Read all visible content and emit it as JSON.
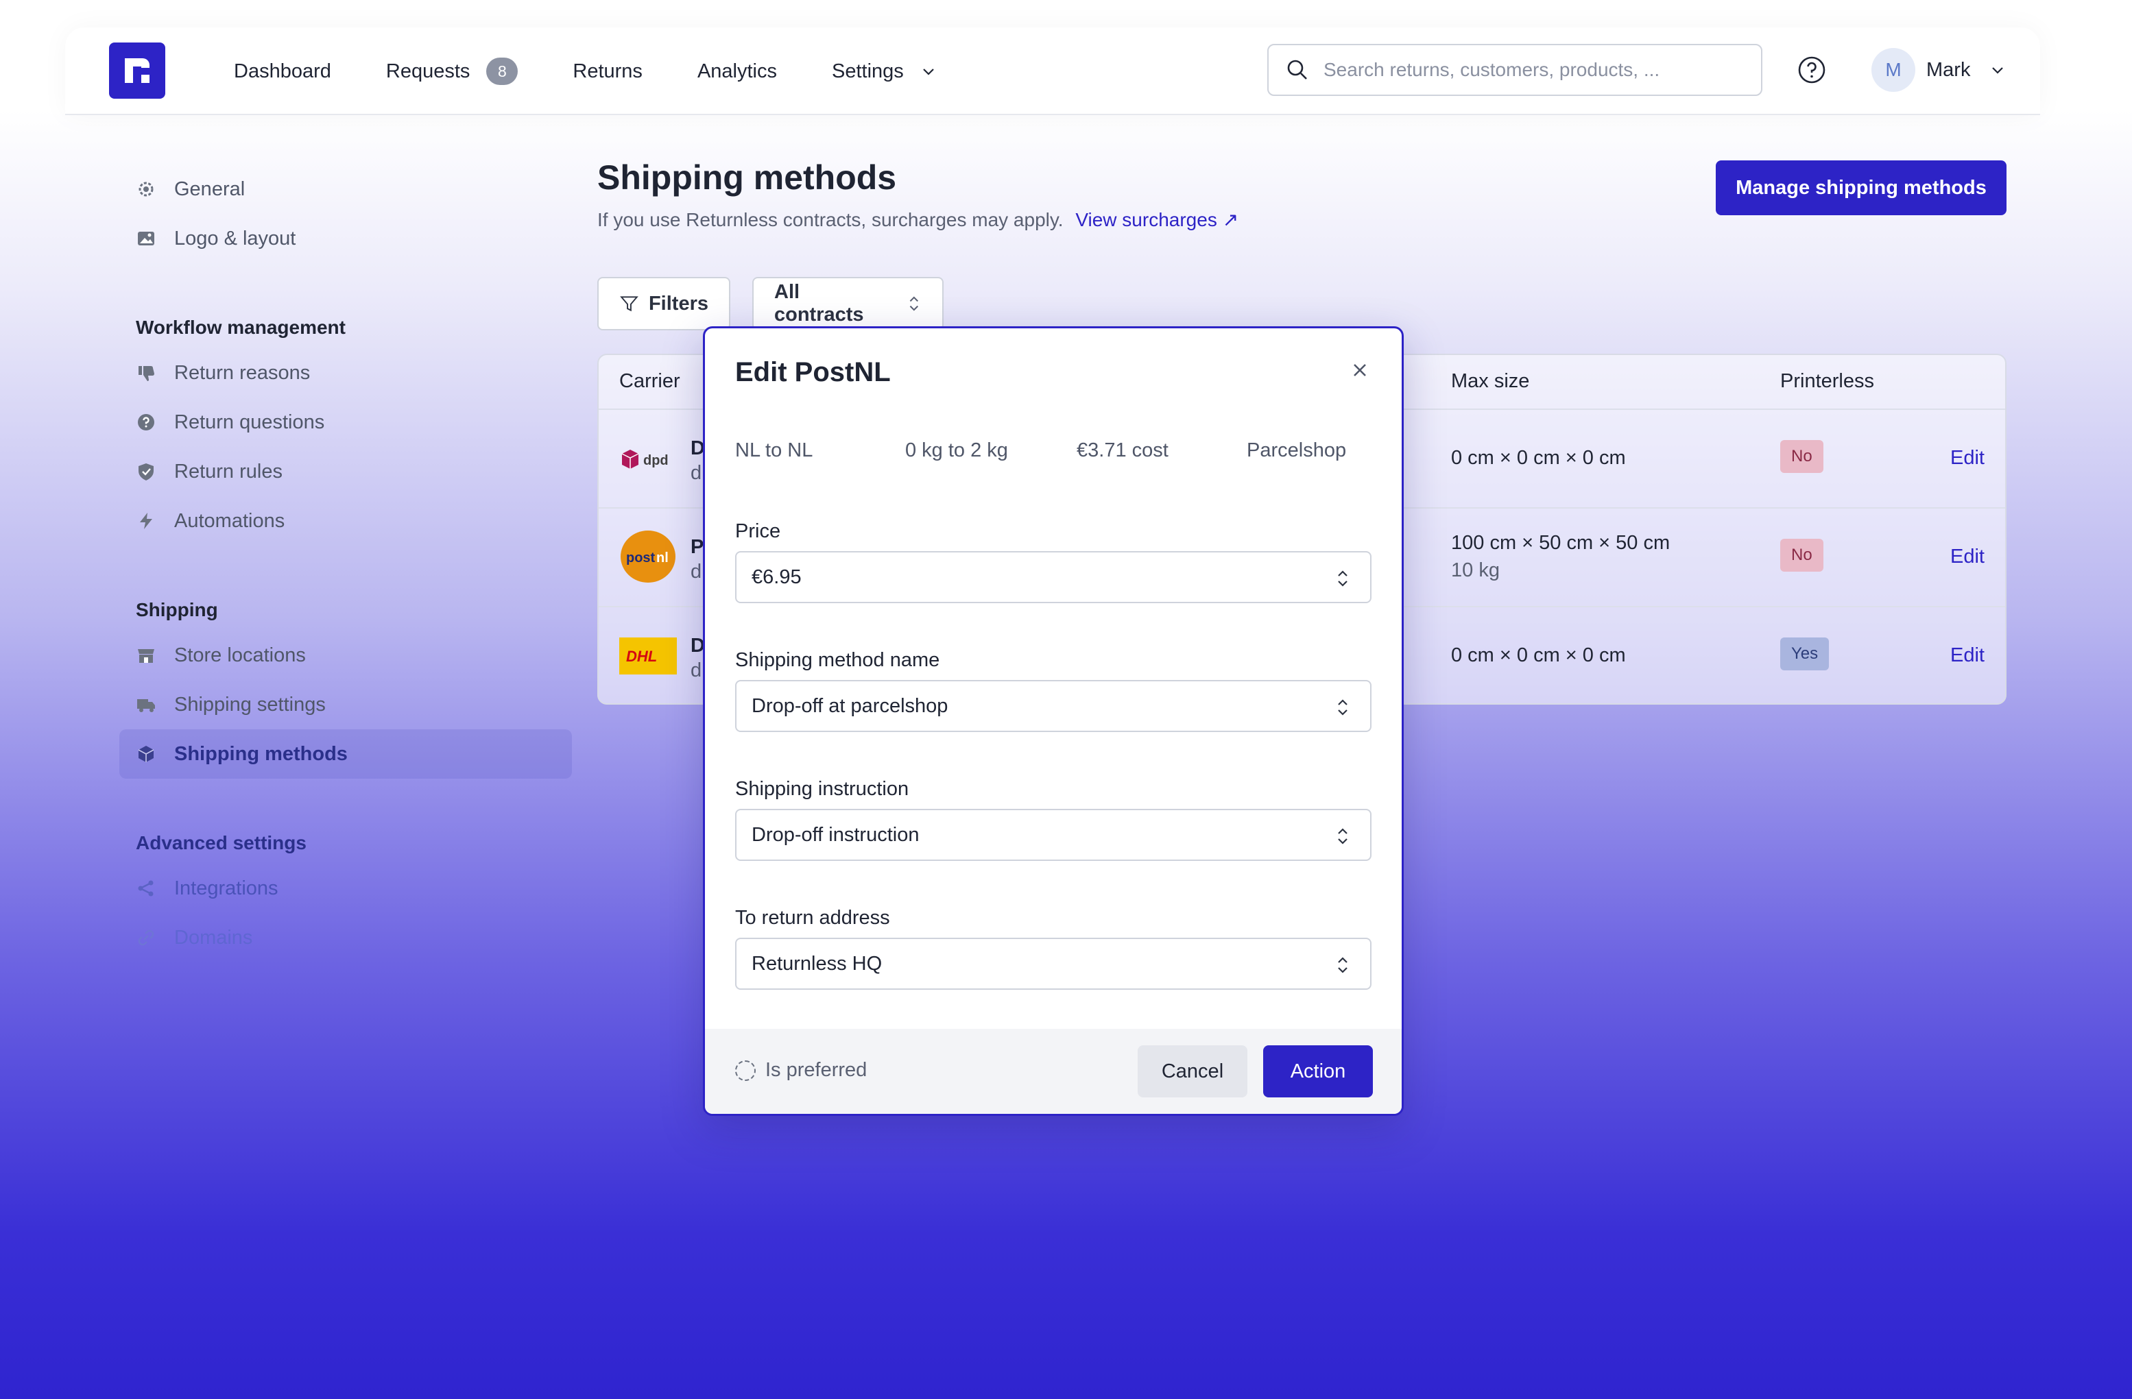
{
  "nav": {
    "items": [
      {
        "label": "Dashboard"
      },
      {
        "label": "Requests",
        "badge": "8"
      },
      {
        "label": "Returns"
      },
      {
        "label": "Analytics"
      },
      {
        "label": "Settings"
      }
    ],
    "search_placeholder": "Search returns, customers, products, ...",
    "user_initial": "M",
    "user_name": "Mark"
  },
  "sidebar": {
    "top_items": [
      {
        "label": "General",
        "icon": "gear-icon"
      },
      {
        "label": "Logo & layout",
        "icon": "image-icon"
      }
    ],
    "sections": [
      {
        "heading": "Workflow management",
        "items": [
          {
            "label": "Return reasons",
            "icon": "thumbs-down-icon"
          },
          {
            "label": "Return questions",
            "icon": "question-circle-icon"
          },
          {
            "label": "Return rules",
            "icon": "shield-icon"
          },
          {
            "label": "Automations",
            "icon": "bolt-icon"
          }
        ]
      },
      {
        "heading": "Shipping",
        "items": [
          {
            "label": "Store locations",
            "icon": "store-icon"
          },
          {
            "label": "Shipping settings",
            "icon": "truck-icon"
          },
          {
            "label": "Shipping methods",
            "icon": "cube-icon",
            "active": true
          }
        ]
      },
      {
        "heading": "Advanced settings",
        "items": [
          {
            "label": "Integrations",
            "icon": "share-icon"
          },
          {
            "label": "Domains",
            "icon": "link-icon"
          }
        ]
      }
    ]
  },
  "main": {
    "title": "Shipping methods",
    "subtitle": "If you use Returnless contracts, surcharges may apply.",
    "surcharges_link": "View surcharges ↗",
    "manage_button": "Manage shipping methods",
    "filters_button": "Filters",
    "contracts_select": "All contracts",
    "table": {
      "headers": {
        "carrier": "Carrier",
        "max_size": "Max size",
        "printerless": "Printerless"
      },
      "rows": [
        {
          "carrier_initial": "D",
          "carrier_sub": "d",
          "logo": "dpd",
          "size": "0 cm × 0 cm × 0 cm",
          "weight": "",
          "printerless": "No",
          "edit": "Edit"
        },
        {
          "carrier_initial": "P",
          "carrier_sub": "d",
          "logo": "postnl",
          "size": "100 cm × 50 cm × 50 cm",
          "weight": "10 kg",
          "printerless": "No",
          "edit": "Edit"
        },
        {
          "carrier_initial": "D",
          "carrier_sub": "d",
          "logo": "dhl",
          "size": "0 cm × 0 cm × 0 cm",
          "weight": "",
          "printerless": "Yes",
          "edit": "Edit"
        }
      ]
    }
  },
  "modal": {
    "title": "Edit PostNL",
    "meta": {
      "route": "NL to NL",
      "weight": "0 kg to 2 kg",
      "cost": "€3.71 cost",
      "type": "Parcelshop"
    },
    "fields": {
      "price": {
        "label": "Price",
        "value": "€6.95"
      },
      "method_name": {
        "label": "Shipping method name",
        "value": "Drop-off at parcelshop"
      },
      "instruction": {
        "label": "Shipping instruction",
        "value": "Drop-off instruction"
      },
      "return_address": {
        "label": "To return address",
        "value": "Returnless HQ"
      }
    },
    "preferred_label": "Is preferred",
    "cancel_label": "Cancel",
    "action_label": "Action"
  },
  "colors": {
    "brand": "#2d23c6",
    "no_badge": "#e9b9c7",
    "yes_badge": "#a9b5df"
  }
}
